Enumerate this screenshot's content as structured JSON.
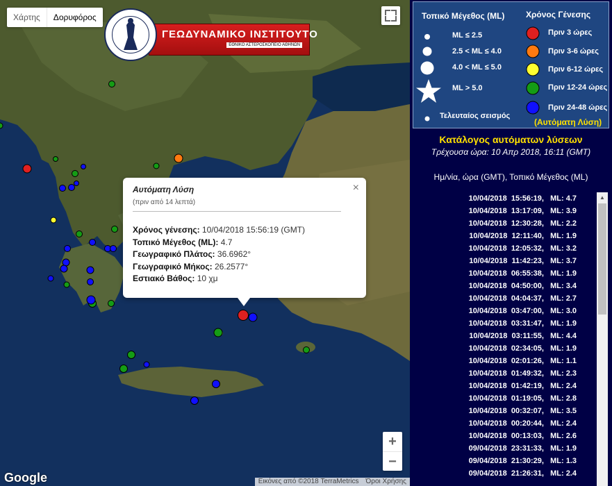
{
  "map": {
    "maptype_buttons": [
      "Χάρτης",
      "Δορυφόρος"
    ],
    "active_maptype": "Δορυφόρος",
    "logo": {
      "title": "ΓΕΩΔΥΝΑΜΙΚΟ ΙΝΣΤΙΤΟΥΤΟ",
      "subtitle": "ΕΘΝΙΚΟ ΑΣΤΕΡΟΣΚΟΠΕΙΟ ΑΘΗΝΩΝ"
    },
    "google_label": "Google",
    "attribution": [
      "Εικόνες από ©2018 TerraMetrics",
      "Όροι Χρήσης"
    ],
    "zoom": {
      "in": "+",
      "out": "−"
    },
    "colors": {
      "red": "#e02020",
      "orange": "#ff7a10",
      "yellow": "#ffff30",
      "green": "#159c15",
      "blue": "#1010ff"
    }
  },
  "popup": {
    "title": "Αυτόματη Λύση",
    "subtitle": "(πριν από 14 λεπτά)",
    "close": "×",
    "rows": [
      {
        "label": "Χρόνος γένεσης:",
        "value": "10/04/2018  15:56:19 (GMT)"
      },
      {
        "label": "Τοπικό Μέγεθος (ML):",
        "value": "4.7"
      },
      {
        "label": "Γεωγραφικό Πλάτος:",
        "value": "36.6962°"
      },
      {
        "label": "Γεωγραφικό Μήκος:",
        "value": "26.2577°"
      },
      {
        "label": "Εστιακό Βάθος:",
        "value": "10 χμ"
      }
    ]
  },
  "legend": {
    "magnitude_title": "Τοπικό Μέγεθος (ML)",
    "time_title": "Χρόνος Γένεσης",
    "magnitudes": [
      "ML ≤ 2.5",
      "2.5 < ML ≤ 4.0",
      "4.0 < ML ≤ 5.0",
      "ML > 5.0"
    ],
    "latest": "Τελευταίος σεισμός",
    "times": [
      {
        "label": "Πριν 3 ώρες",
        "color": "#e02020"
      },
      {
        "label": "Πριν 3-6 ώρες",
        "color": "#ff7a10"
      },
      {
        "label": "Πριν 6-12 ώρες",
        "color": "#ffff30"
      },
      {
        "label": "Πριν 12-24 ώρες",
        "color": "#159c15"
      },
      {
        "label": "Πριν 24-48 ώρες",
        "color": "#1010ff"
      }
    ],
    "auto_note": "(Αυτόματη Λύση)"
  },
  "catalog": {
    "title": "Κατάλογος αυτόματων λύσεων",
    "current_time": "Τρέχουσα ώρα: 10 Απρ 2018, 16:11 (GMT)",
    "header": "Ημ/νία, ώρα (GMT), Τοπικό Μέγεθος (ML)",
    "items": [
      "10/04/2018  15:56:19,   ML: 4.7",
      "10/04/2018  13:17:09,   ML: 3.9",
      "10/04/2018  12:30:28,   ML: 2.2",
      "10/04/2018  12:11:40,   ML: 1.9",
      "10/04/2018  12:05:32,   ML: 3.2",
      "10/04/2018  11:42:23,   ML: 3.7",
      "10/04/2018  06:55:38,   ML: 1.9",
      "10/04/2018  04:50:00,   ML: 3.4",
      "10/04/2018  04:04:37,   ML: 2.7",
      "10/04/2018  03:47:00,   ML: 3.0",
      "10/04/2018  03:31:47,   ML: 1.9",
      "10/04/2018  03:11:55,   ML: 4.4",
      "10/04/2018  02:34:05,   ML: 1.9",
      "10/04/2018  02:01:26,   ML: 1.1",
      "10/04/2018  01:49:32,   ML: 2.3",
      "10/04/2018  01:42:19,   ML: 2.4",
      "10/04/2018  01:19:05,   ML: 2.8",
      "10/04/2018  00:32:07,   ML: 3.5",
      "10/04/2018  00:20:44,   ML: 2.4",
      "10/04/2018  00:13:03,   ML: 2.6",
      "09/04/2018  23:31:33,   ML: 1.9",
      "09/04/2018  21:30:29,   ML: 1.3",
      "09/04/2018  21:26:31,   ML: 2.4"
    ]
  }
}
